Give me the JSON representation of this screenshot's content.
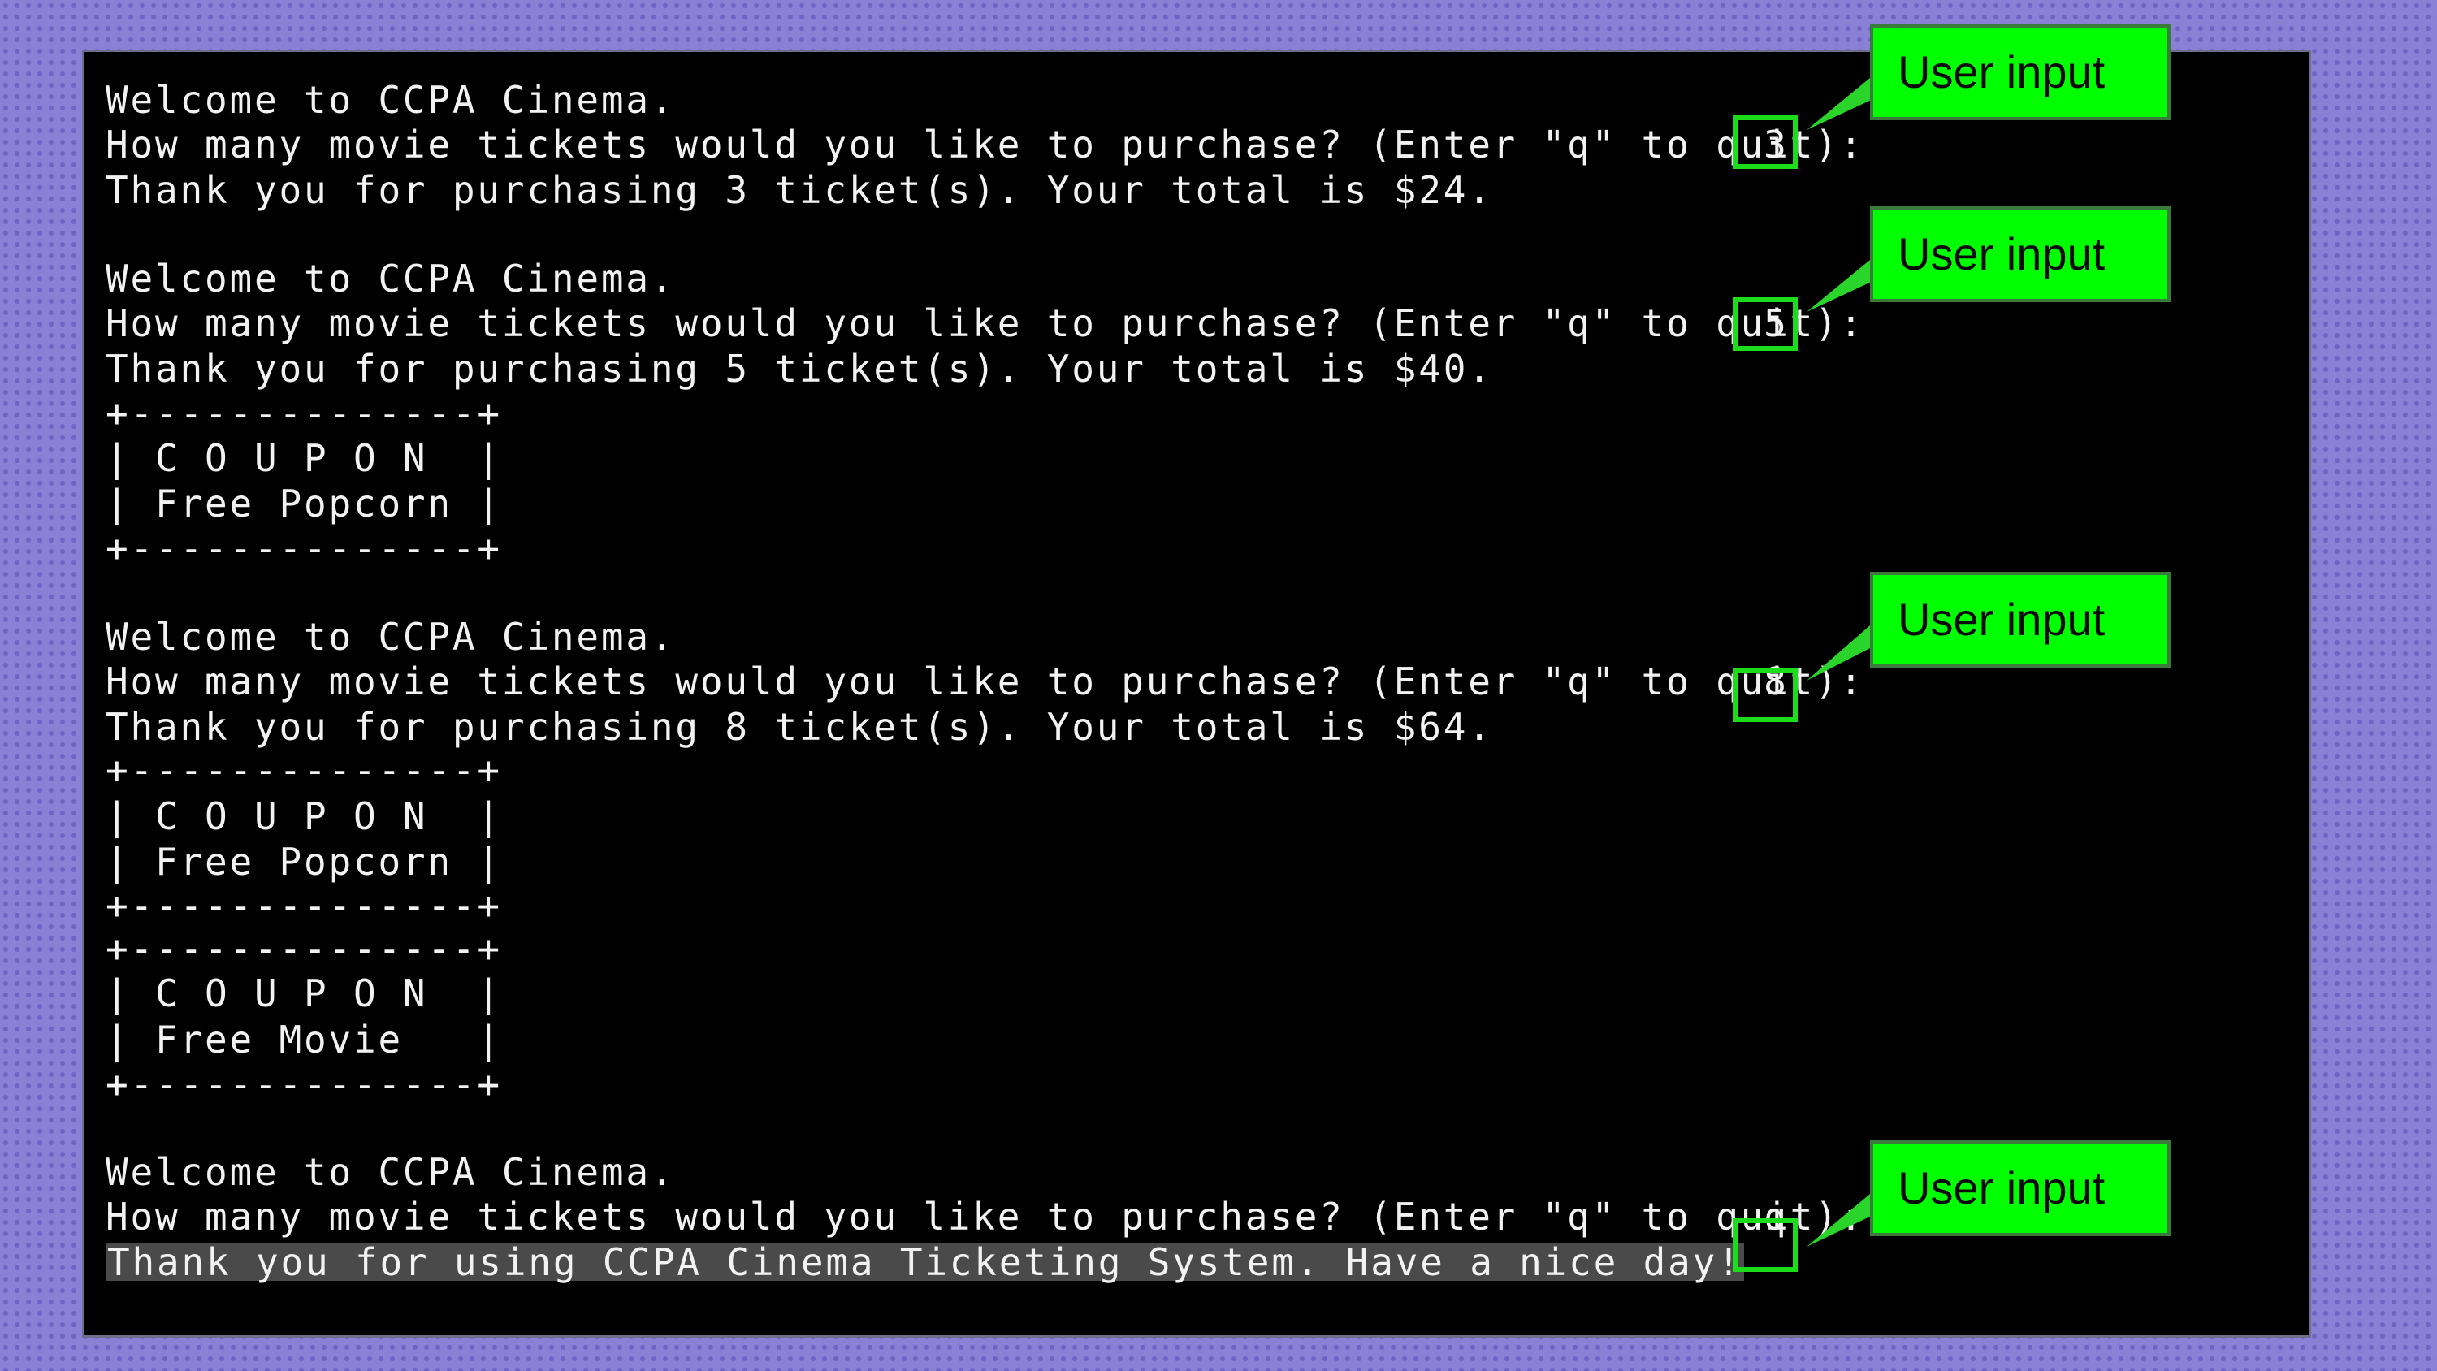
{
  "terminal": {
    "lines": [
      "Welcome to CCPA Cinema.",
      "How many movie tickets would you like to purchase? (Enter \"q\" to quit):",
      "Thank you for purchasing 3 ticket(s). Your total is $24.",
      "Welcome to CCPA Cinema.",
      "How many movie tickets would you like to purchase? (Enter \"q\" to quit):",
      "Thank you for purchasing 5 ticket(s). Your total is $40.",
      "+--------------+",
      "| C O U P O N  |",
      "| Free Popcorn |",
      "+--------------+",
      "Welcome to CCPA Cinema.",
      "How many movie tickets would you like to purchase? (Enter \"q\" to quit):",
      "Thank you for purchasing 8 ticket(s). Your total is $64.",
      "+--------------+",
      "| C O U P O N  |",
      "| Free Popcorn |",
      "+--------------+",
      "+--------------+",
      "| C O U P O N  |",
      "| Free Movie   |",
      "+--------------+",
      "Welcome to CCPA Cinema.",
      "How many movie tickets would you like to purchase? (Enter \"q\" to quit):",
      "Thank you for using CCPA Cinema Ticketing System. Have a nice day!"
    ],
    "inputs": [
      "3",
      "5",
      "8",
      "q"
    ]
  },
  "callouts": [
    "User input",
    "User input",
    "User input",
    "User input"
  ],
  "colors": {
    "background": "#8a80d6",
    "terminal_bg": "#000000",
    "terminal_text": "#f2f2f2",
    "callout_fill": "#00ff00",
    "input_box_border": "#1cdc1c",
    "highlight": "#4a4a4a"
  }
}
